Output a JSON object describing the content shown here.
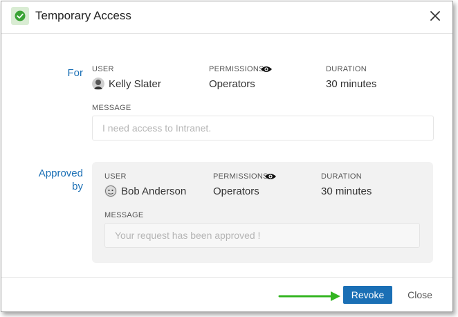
{
  "dialog": {
    "title": "Temporary Access",
    "badge_icon": "check-circle-icon",
    "close_icon": "close-icon",
    "accent_color": "#1a6fb5",
    "badge_color": "#3aa335"
  },
  "request": {
    "section_label": "For",
    "user_label": "USER",
    "user_name": "Kelly Slater",
    "permissions_label": "PERMISSIONS",
    "permissions_value": "Operators",
    "duration_label": "DURATION",
    "duration_value": "30 minutes",
    "message_label": "MESSAGE",
    "message_placeholder": "I need access to Intranet."
  },
  "approval": {
    "section_label_line1": "Approved",
    "section_label_line2": "by",
    "user_label": "USER",
    "user_name": "Bob Anderson",
    "permissions_label": "PERMISSIONS",
    "permissions_value": "Operators",
    "duration_label": "DURATION",
    "duration_value": "30 minutes",
    "message_label": "MESSAGE",
    "message_placeholder": "Your request has been approved !"
  },
  "footer": {
    "revoke_label": "Revoke",
    "close_label": "Close",
    "annotation_arrow_color": "#33b521"
  }
}
